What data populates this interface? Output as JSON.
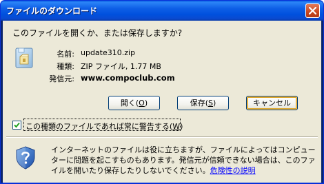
{
  "window": {
    "title": "ファイルのダウンロード"
  },
  "dialog": {
    "heading": "このファイルを開くか、または保存しますか?",
    "file_icon": "zip-file-icon",
    "info": {
      "name_label": "名前:",
      "name_value": "update310.zip",
      "type_label": "種類:",
      "type_value": "ZIP ファイル, 1.77 MB",
      "from_label": "発信元:",
      "from_value": "www.compoclub.com"
    },
    "buttons": {
      "open_label": "開く(",
      "open_key": "O",
      "open_suffix": ")",
      "save_label": "保存(",
      "save_key": "S",
      "save_suffix": ")",
      "cancel_label": "キャンセル"
    },
    "checkbox": {
      "checked": true,
      "label": "この種類のファイルであれば常に警告する(",
      "key": "W",
      "suffix": ")"
    },
    "warning": {
      "icon": "security-shield-icon",
      "text": "インターネットのファイルは役に立ちますが、ファイルによってはコンピューターに問題を起こすものもあります。発信元が信頼できない場合は、このファイルを開いたり保存したりしないでください。",
      "link": "危険性の説明"
    }
  },
  "colors": {
    "titlebar": "#0054e3",
    "client_bg": "#ece9d8",
    "link": "#0000ff",
    "close_button": "#c9471f"
  }
}
